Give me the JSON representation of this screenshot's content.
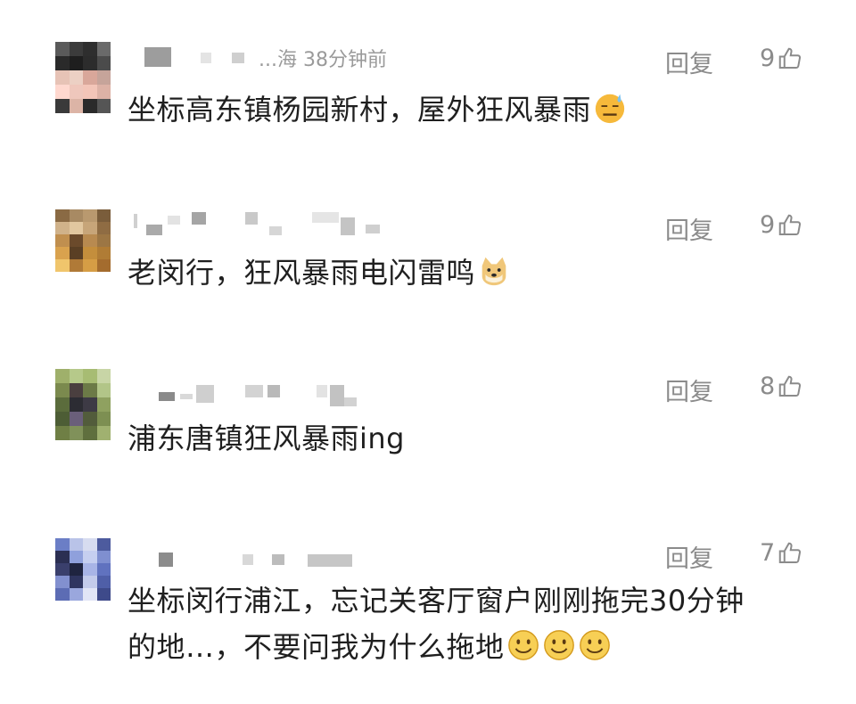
{
  "reply_label": "回复",
  "comments": [
    {
      "name_visible": "...海 38分钟前",
      "text": "坐标高东镇杨园新村，屋外狂风暴雨",
      "likes": "9",
      "emoji": "sweat-smile-emoji"
    },
    {
      "text": "老闵行，狂风暴雨电闪雷鸣",
      "likes": "9",
      "emoji": "doge-emoji"
    },
    {
      "text": "浦东唐镇狂风暴雨ing",
      "likes": "8"
    },
    {
      "text_line1": "坐标闵行浦江，忘记关客厅窗户刚刚拖完30分钟",
      "text_line2": "的地…，不要问我为什么拖地",
      "likes": "7",
      "emoji": "smile-emoji"
    }
  ]
}
